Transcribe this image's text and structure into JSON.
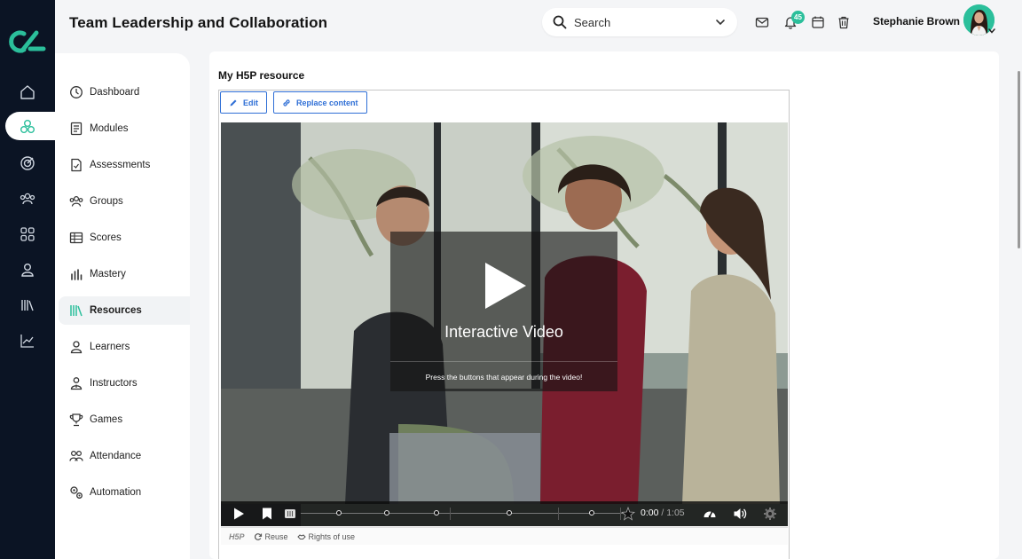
{
  "header": {
    "title": "Team Leadership and Collaboration",
    "search_placeholder": "Search",
    "notification_count": "45",
    "user_name": "Stephanie Brown"
  },
  "rail": {
    "icons": [
      "home-icon",
      "modules-icon",
      "assessments-icon",
      "groups-icon",
      "apps-icon",
      "user-icon",
      "library-icon",
      "analytics-icon"
    ],
    "active_index": 1
  },
  "sidebar": {
    "items": [
      {
        "label": "Dashboard",
        "icon": "dashboard-icon"
      },
      {
        "label": "Modules",
        "icon": "modules-icon"
      },
      {
        "label": "Assessments",
        "icon": "assessments-icon"
      },
      {
        "label": "Groups",
        "icon": "groups-icon"
      },
      {
        "label": "Scores",
        "icon": "scores-icon"
      },
      {
        "label": "Mastery",
        "icon": "mastery-icon"
      },
      {
        "label": "Resources",
        "icon": "resources-icon",
        "active": true
      },
      {
        "label": "Learners",
        "icon": "learners-icon"
      },
      {
        "label": "Instructors",
        "icon": "instructors-icon"
      },
      {
        "label": "Games",
        "icon": "games-icon"
      },
      {
        "label": "Attendance",
        "icon": "attendance-icon"
      },
      {
        "label": "Automation",
        "icon": "automation-icon"
      }
    ]
  },
  "resource": {
    "title": "My H5P resource",
    "edit_label": "Edit",
    "replace_label": "Replace content"
  },
  "video": {
    "title": "Interactive Video",
    "subtitle": "Press the buttons that appear during the video!",
    "current_time": "0:00",
    "duration": "/ 1:05",
    "progress": 0
  },
  "h5p": {
    "logo": "H5P",
    "reuse_label": "Reuse",
    "rights_label": "Rights of use"
  },
  "colors": {
    "accent": "#2bbf9b",
    "rail_bg": "#0b1424",
    "link_blue": "#2f6fd6"
  }
}
